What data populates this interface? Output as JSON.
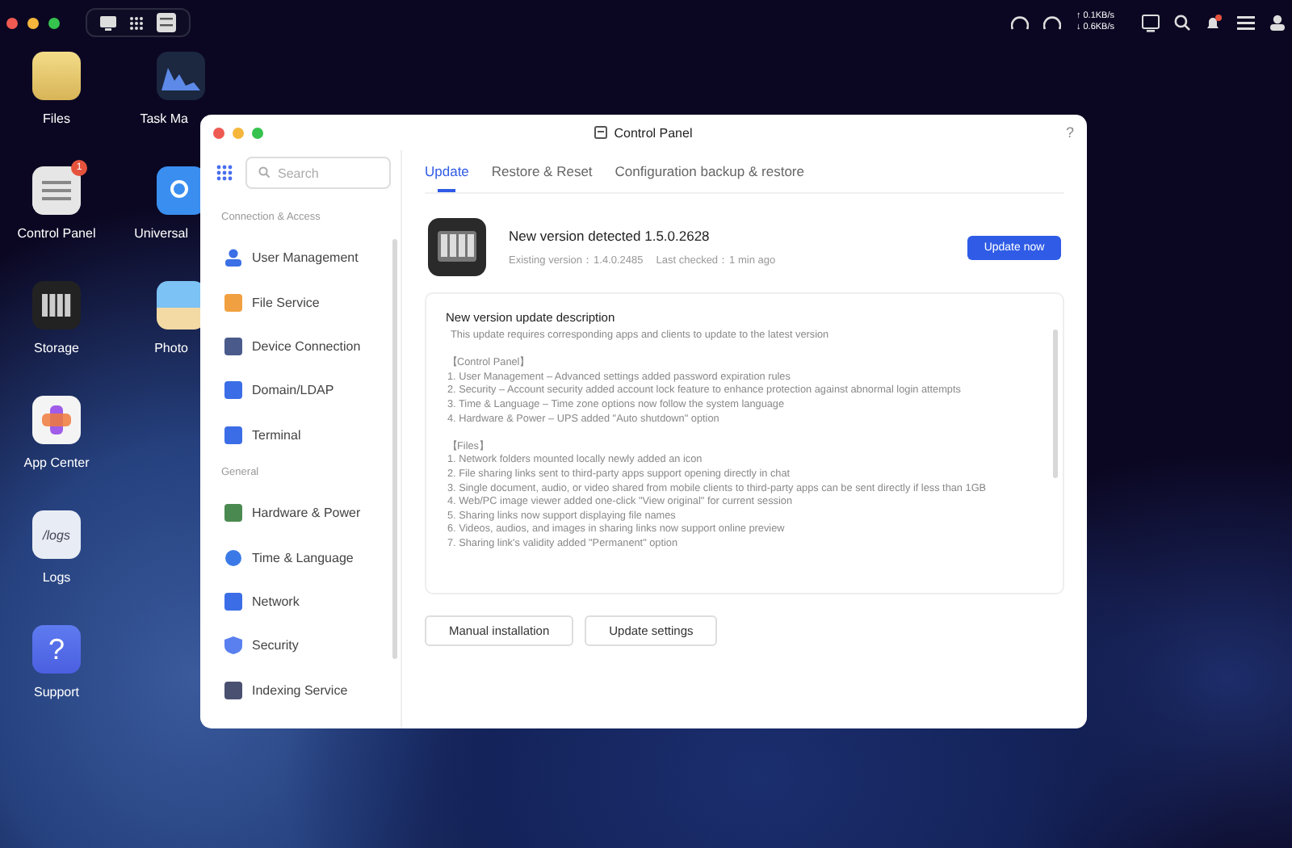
{
  "topbar": {
    "network_up": "↑ 0.1KB/s",
    "network_down": "↓ 0.6KB/s",
    "notification": true
  },
  "desktop_icons": [
    {
      "label": "Files",
      "kind": "folder"
    },
    {
      "label": "Control Panel",
      "kind": "settings",
      "badge": "1"
    },
    {
      "label": "Storage",
      "kind": "storage"
    },
    {
      "label": "App Center",
      "kind": "apps"
    },
    {
      "label": "Logs",
      "kind": "logs",
      "icon_text": "/logs"
    },
    {
      "label": "Support",
      "kind": "help",
      "icon_text": "?"
    },
    {
      "label": "Task Ma",
      "kind": "chart"
    },
    {
      "label": "Universal",
      "kind": "search"
    },
    {
      "label": "Photo",
      "kind": "photo"
    }
  ],
  "window": {
    "title": "Control Panel",
    "help": "?"
  },
  "sidebar": {
    "search": {
      "placeholder": "Search"
    },
    "sections": [
      {
        "heading": "Connection & Access",
        "items": [
          {
            "label": "User Management",
            "kind": "user"
          },
          {
            "label": "File Service",
            "kind": "folder"
          },
          {
            "label": "Device Connection",
            "kind": "device"
          },
          {
            "label": "Domain/LDAP",
            "kind": "domain"
          },
          {
            "label": "Terminal",
            "kind": "terminal"
          }
        ]
      },
      {
        "heading": "General",
        "items": [
          {
            "label": "Hardware & Power",
            "kind": "hardware"
          },
          {
            "label": "Time & Language",
            "kind": "globe"
          },
          {
            "label": "Network",
            "kind": "network"
          },
          {
            "label": "Security",
            "kind": "shield"
          },
          {
            "label": "Indexing Service",
            "kind": "index"
          }
        ]
      }
    ]
  },
  "tabs": [
    {
      "label": "Update",
      "selected": true
    },
    {
      "label": "Restore & Reset",
      "selected": false
    },
    {
      "label": "Configuration backup & restore",
      "selected": false
    }
  ],
  "update": {
    "title": "New version detected 1.5.0.2628",
    "existing_version": "Existing version：1.4.0.2485",
    "last_checked": "Last checked：1 min ago",
    "button": "Update now"
  },
  "description": {
    "heading": "New version update description",
    "lines": [
      {
        "kind": "intro",
        "text": "This update requires corresponding apps and clients to update to the latest version"
      },
      {
        "kind": "section",
        "text": "【Control Panel】"
      },
      {
        "kind": "item",
        "text": "1. User Management – Advanced settings added password expiration rules"
      },
      {
        "kind": "item",
        "text": "2. Security – Account security added account lock feature to enhance protection against abnormal login attempts"
      },
      {
        "kind": "item",
        "text": "3. Time & Language – Time zone options now follow the system language"
      },
      {
        "kind": "item",
        "text": "4. Hardware & Power – UPS added \"Auto shutdown\" option"
      },
      {
        "kind": "section",
        "text": "【Files】"
      },
      {
        "kind": "item",
        "text": "1. Network folders mounted locally newly added an icon"
      },
      {
        "kind": "item",
        "text": "2. File sharing links sent to third-party apps support opening directly in chat"
      },
      {
        "kind": "item",
        "text": "3. Single document, audio, or video shared from mobile clients to third-party apps can be sent directly if less than 1GB"
      },
      {
        "kind": "item",
        "text": "4. Web/PC image viewer added one-click \"View original\" for current session"
      },
      {
        "kind": "item",
        "text": "5. Sharing links now support displaying file names"
      },
      {
        "kind": "item",
        "text": "6. Videos, audios, and images in sharing links now support online preview"
      },
      {
        "kind": "item",
        "text": "7. Sharing link's validity added \"Permanent\" option"
      }
    ]
  },
  "buttons": [
    "Manual installation",
    "Update settings"
  ]
}
